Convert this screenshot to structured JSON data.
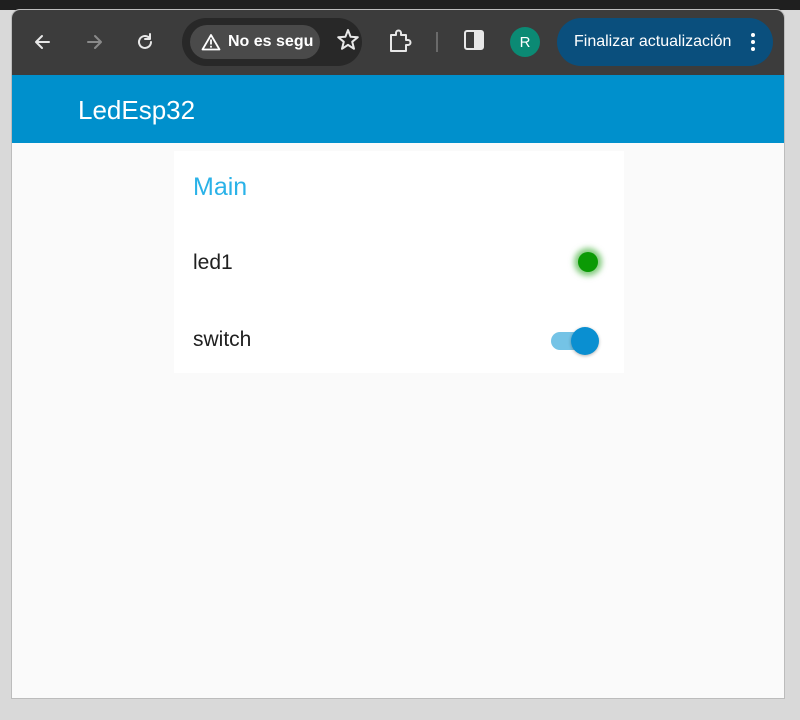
{
  "browser": {
    "security_chip_label": "No es segu",
    "profile_initial": "R",
    "update_button_label": "Finalizar actualización",
    "icons": [
      "back-arrow-icon",
      "forward-arrow-icon",
      "reload-icon",
      "warning-icon",
      "bookmark-star-icon",
      "extensions-icon",
      "side-panel-icon",
      "kebab-menu-icon"
    ]
  },
  "app": {
    "title": "LedEsp32",
    "accent_color": "#0090cc"
  },
  "card": {
    "title": "Main",
    "rows": [
      {
        "label": "led1",
        "type": "led",
        "state": "on",
        "color": "#0b9a05"
      },
      {
        "label": "switch",
        "type": "toggle",
        "state": "on",
        "color": "#0a8fd1"
      }
    ]
  }
}
